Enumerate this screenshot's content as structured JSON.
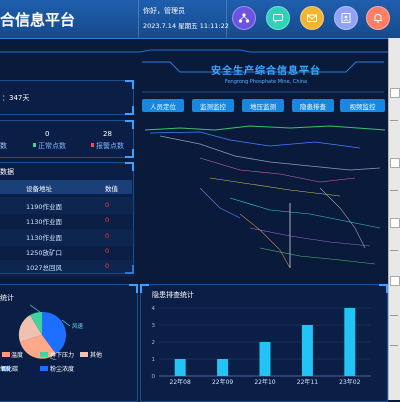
{
  "header": {
    "app_title": "合信息平台",
    "greeting": "你好，管理员",
    "datetime": "2023.7.14 星期五 11:11:22",
    "icons": [
      "network-icon",
      "message-icon",
      "mail-icon",
      "user-card-icon",
      "alarm-bell-icon"
    ],
    "icon_colors": [
      "#6b55e0",
      "#2fd2b8",
      "#f2b531",
      "#8fa2f5",
      "#ff7e66"
    ]
  },
  "safe_days": {
    "label": "：347天"
  },
  "points": {
    "values": [
      "0",
      "28"
    ],
    "labels": [
      "正常点数",
      "报警点数"
    ],
    "left_fragment": "数"
  },
  "device_table": {
    "title_fragment": "数据",
    "headers": [
      "设备地址",
      "数值"
    ],
    "rows": [
      {
        "address": "1190作业面",
        "value": "0"
      },
      {
        "address": "1130作业面",
        "value": "0"
      },
      {
        "address": "1130作业面",
        "value": "0"
      },
      {
        "address": "1250放矿口",
        "value": "0"
      },
      {
        "address": "1027总回风",
        "value": "0"
      }
    ]
  },
  "center": {
    "title": "安全生产综合信息平台",
    "subtitle": "Fengrong Phosphate Mine, China",
    "nav": [
      "人员定位",
      "监测监控",
      "地压监测",
      "隐患排查",
      "视频监控"
    ]
  },
  "pie_panel": {
    "title_fragment": "统计",
    "labels": [
      "风速",
      "温度",
      "井下压力",
      "其他",
      "氧化碳",
      "粉尘浓度"
    ],
    "colors": [
      "#1e6fff",
      "#ff9a7a",
      "#3fd39e",
      "#f0c0b0",
      "#5aa8ff",
      "#6dd6ff"
    ]
  },
  "chart_data": {
    "type": "bar",
    "title": "隐患排查统计",
    "categories": [
      "22年08",
      "22年09",
      "22年10",
      "22年11",
      "23年02"
    ],
    "values": [
      1,
      1,
      2,
      3,
      4
    ],
    "ylim": [
      0,
      4
    ],
    "yticks": [
      "0",
      "1",
      "2",
      "3",
      "4"
    ],
    "bar_color": "#22c3f5",
    "grid": true
  }
}
